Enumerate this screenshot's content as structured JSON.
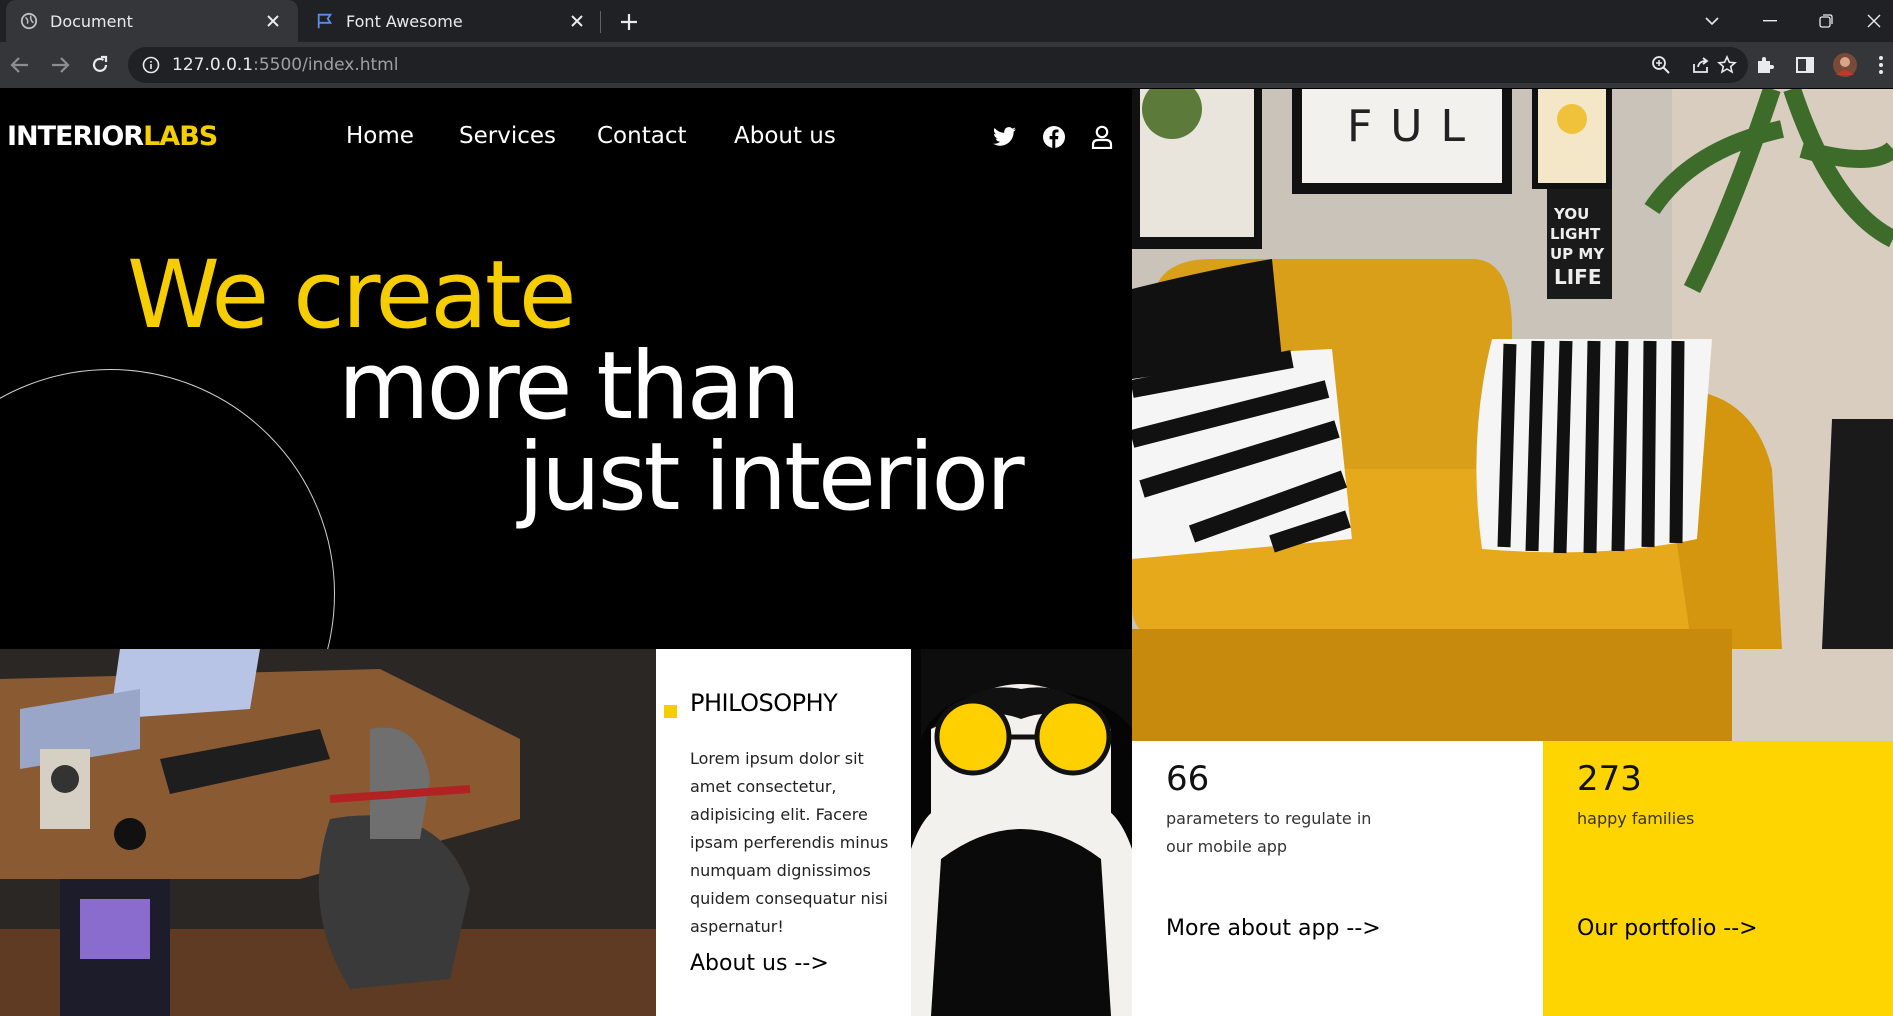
{
  "browser": {
    "tabs": [
      {
        "title": "Document",
        "icon": "globe-icon",
        "active": true
      },
      {
        "title": "Font Awesome",
        "icon": "flag-icon",
        "active": false
      }
    ],
    "url_host": "127.0.0.1",
    "url_rest": ":5500/index.html"
  },
  "site": {
    "logo_main": "INTERIOR",
    "logo_accent": "LABS",
    "nav": [
      "Home",
      "Services",
      "Contact",
      "About us"
    ],
    "social_icons": [
      "twitter-icon",
      "facebook-icon",
      "user-icon"
    ],
    "hero": {
      "line1": "We create",
      "line2": "more than",
      "line3": "just interior"
    },
    "philosophy": {
      "title": "PHILOSOPHY",
      "body": "Lorem ipsum dolor sit amet consectetur, adipisicing elit. Facere ipsam perferendis minus numquam dignissimos quidem consequatur nisi aspernatur!",
      "link": "About us -->"
    },
    "stats": [
      {
        "number": "66",
        "label": "parameters to regulate in our mobile app",
        "link": "More about app -->"
      },
      {
        "number": "273",
        "label": "happy families",
        "link": "Our portfolio -->"
      }
    ],
    "colors": {
      "accent": "#f5cd00",
      "background": "#000000",
      "panel": "#ffffff",
      "yellow_panel": "#fed501"
    }
  }
}
